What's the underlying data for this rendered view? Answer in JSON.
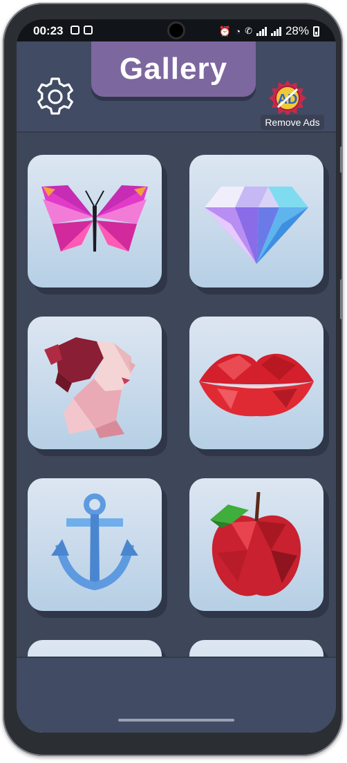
{
  "status_bar": {
    "time": "00:23",
    "battery": "28%",
    "left_icons": [
      "image-icon",
      "app-icon"
    ],
    "right_icons": [
      "alarm-icon",
      "wifi-icon",
      "call-icon",
      "signal-icon",
      "signal-icon",
      "battery-icon"
    ]
  },
  "header": {
    "title": "Gallery",
    "settings_icon": "gear-icon",
    "remove_ads_icon": "ad-badge-icon",
    "remove_ads_label": "Remove Ads"
  },
  "gallery": {
    "items": [
      {
        "name": "butterfly",
        "icon": "butterfly-icon"
      },
      {
        "name": "diamond",
        "icon": "diamond-icon"
      },
      {
        "name": "woman-portrait",
        "icon": "woman-portrait-icon"
      },
      {
        "name": "lips",
        "icon": "lips-icon"
      },
      {
        "name": "anchor",
        "icon": "anchor-icon"
      },
      {
        "name": "apple",
        "icon": "apple-icon"
      }
    ]
  },
  "colors": {
    "background": "#3e4659",
    "header": "#414b63",
    "title_tab": "#7d679f",
    "card_top": "#dde6f2",
    "card_bottom": "#b6cfe5"
  }
}
